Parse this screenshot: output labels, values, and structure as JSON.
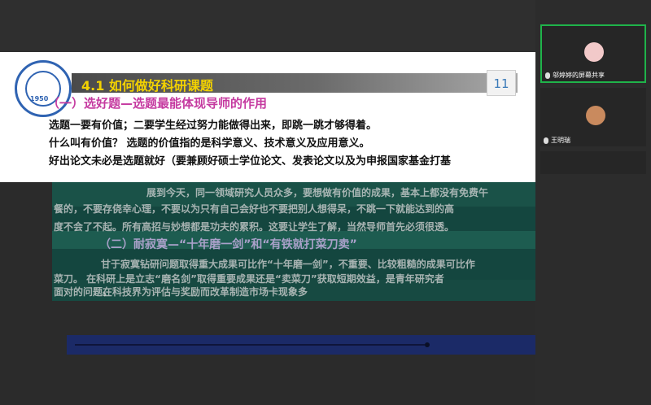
{
  "slide": {
    "title": "4.1  如何做好科研课题",
    "page_number": "11",
    "logo_year": "1950",
    "section1_heading": "（一）选好题—选题最能体现导师的作用",
    "line1": "选题一要有价值；二要学生经过努力能做得出来，即跳一跳才够得着。",
    "line2": "什么叫有价值？ 选题的价值指的是科学意义、技术意义及应用意义。",
    "line3": "好出论文未必是选题就好（要兼顾好硕士学位论文、发表论文以及为申报国家基金打基"
  },
  "garbled": {
    "line1": "展到今天，同一领域研究人员众多，要想做有价值的成果，基本上都没有免费午",
    "line2": "餐的，不要存侥幸心理，不要以为只有自己会好也不要把别人想得呆，不跳一下就能达到的高",
    "line3": "度不会了不起。所有高招与妙想都是功夫的累积。这要让学生了解，当然导师首先必须很透。",
    "section2_heading": "（二）耐寂寞—“十年磨一剑”和“有铁就打菜刀卖”",
    "line4": "甘于寂寞钻研问题取得重大成果可比作“十年磨一剑”，不重要、比较粗糙的成果可比作",
    "line5": "菜刀。 在科研上是立志“磨名剑”取得重要成果还是“卖菜刀”获取短期效益，是青年研究者",
    "line6": "面对的问题。",
    "line7": "在科技界为评估与奖励而改革制造市场卡现象多"
  },
  "participants": [
    {
      "name": "邬婷婷的屏幕共享",
      "active": true,
      "avatar_color": "#f2c9c9"
    },
    {
      "name": "王明瑞",
      "active": false,
      "avatar_color": "#c98a5e"
    }
  ],
  "colors": {
    "accent_green": "#1fb34a",
    "title_yellow": "#f3d200",
    "heading_pink": "#c53aa0"
  }
}
